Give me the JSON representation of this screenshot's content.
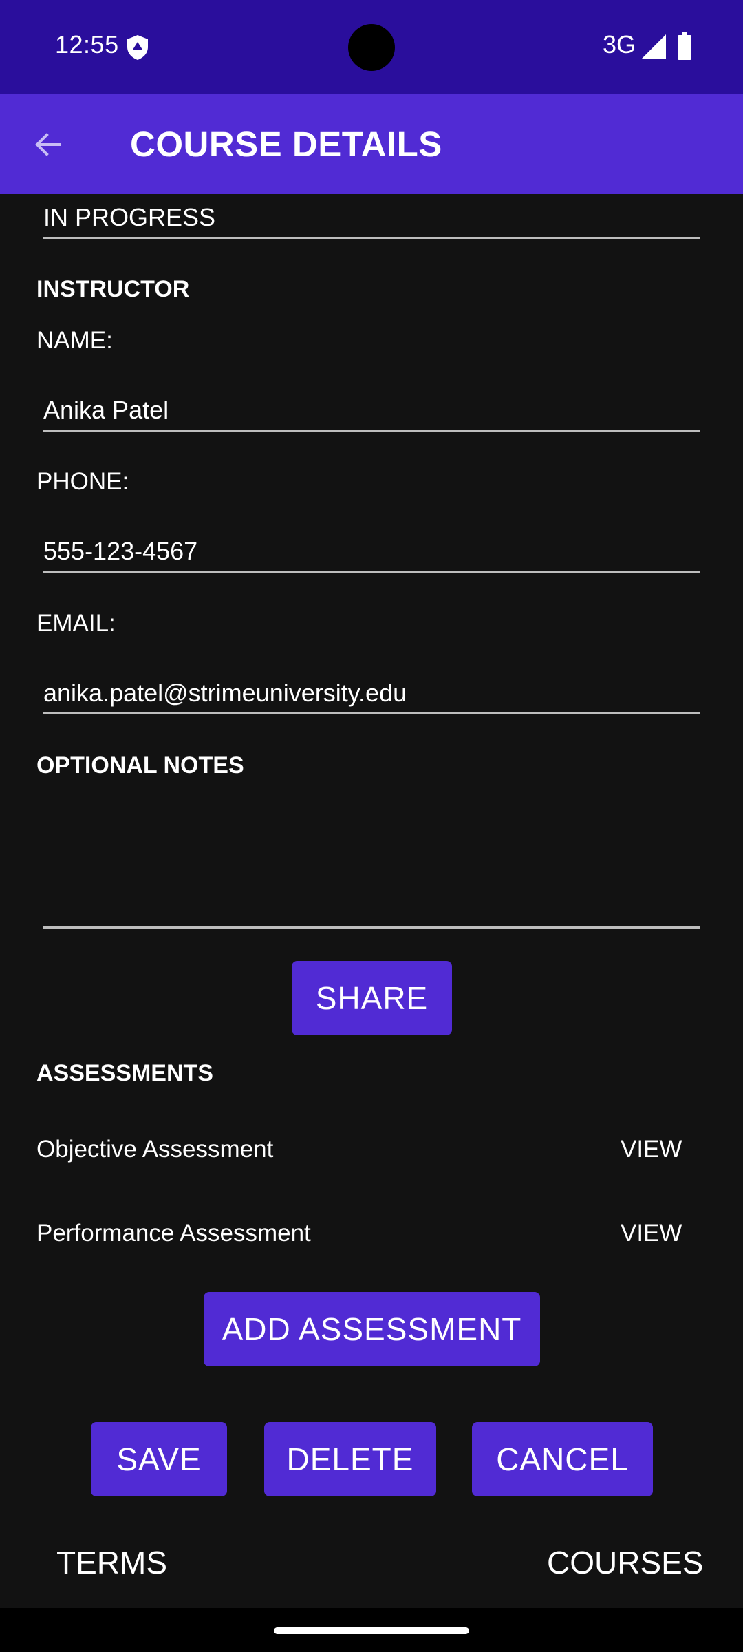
{
  "status_bar": {
    "time": "12:55",
    "network": "3G",
    "icons": [
      "shield-icon",
      "signal-icon",
      "battery-icon"
    ]
  },
  "app_bar": {
    "title": "COURSE DETAILS",
    "back_icon": "arrow-left-icon"
  },
  "course": {
    "status_value": "IN PROGRESS"
  },
  "instructor": {
    "header": "INSTRUCTOR",
    "name_label": "NAME:",
    "name_value": "Anika Patel",
    "phone_label": "PHONE:",
    "phone_value": "555-123-4567",
    "email_label": "EMAIL:",
    "email_value": "anika.patel@strimeuniversity.edu"
  },
  "notes": {
    "header": "OPTIONAL NOTES",
    "value": "",
    "share_label": "SHARE"
  },
  "assessments": {
    "header": "ASSESSMENTS",
    "items": [
      {
        "name": "Objective Assessment",
        "action": "VIEW"
      },
      {
        "name": "Performance Assessment",
        "action": "VIEW"
      }
    ],
    "add_label": "ADD ASSESSMENT"
  },
  "actions": {
    "save_label": "SAVE",
    "delete_label": "DELETE",
    "cancel_label": "CANCEL"
  },
  "bottom_nav": {
    "terms_label": "TERMS",
    "courses_label": "COURSES"
  },
  "colors": {
    "status_bar": "#2a0e9c",
    "primary": "#512bd4",
    "background": "#121212",
    "divider": "#bdbdbd"
  }
}
